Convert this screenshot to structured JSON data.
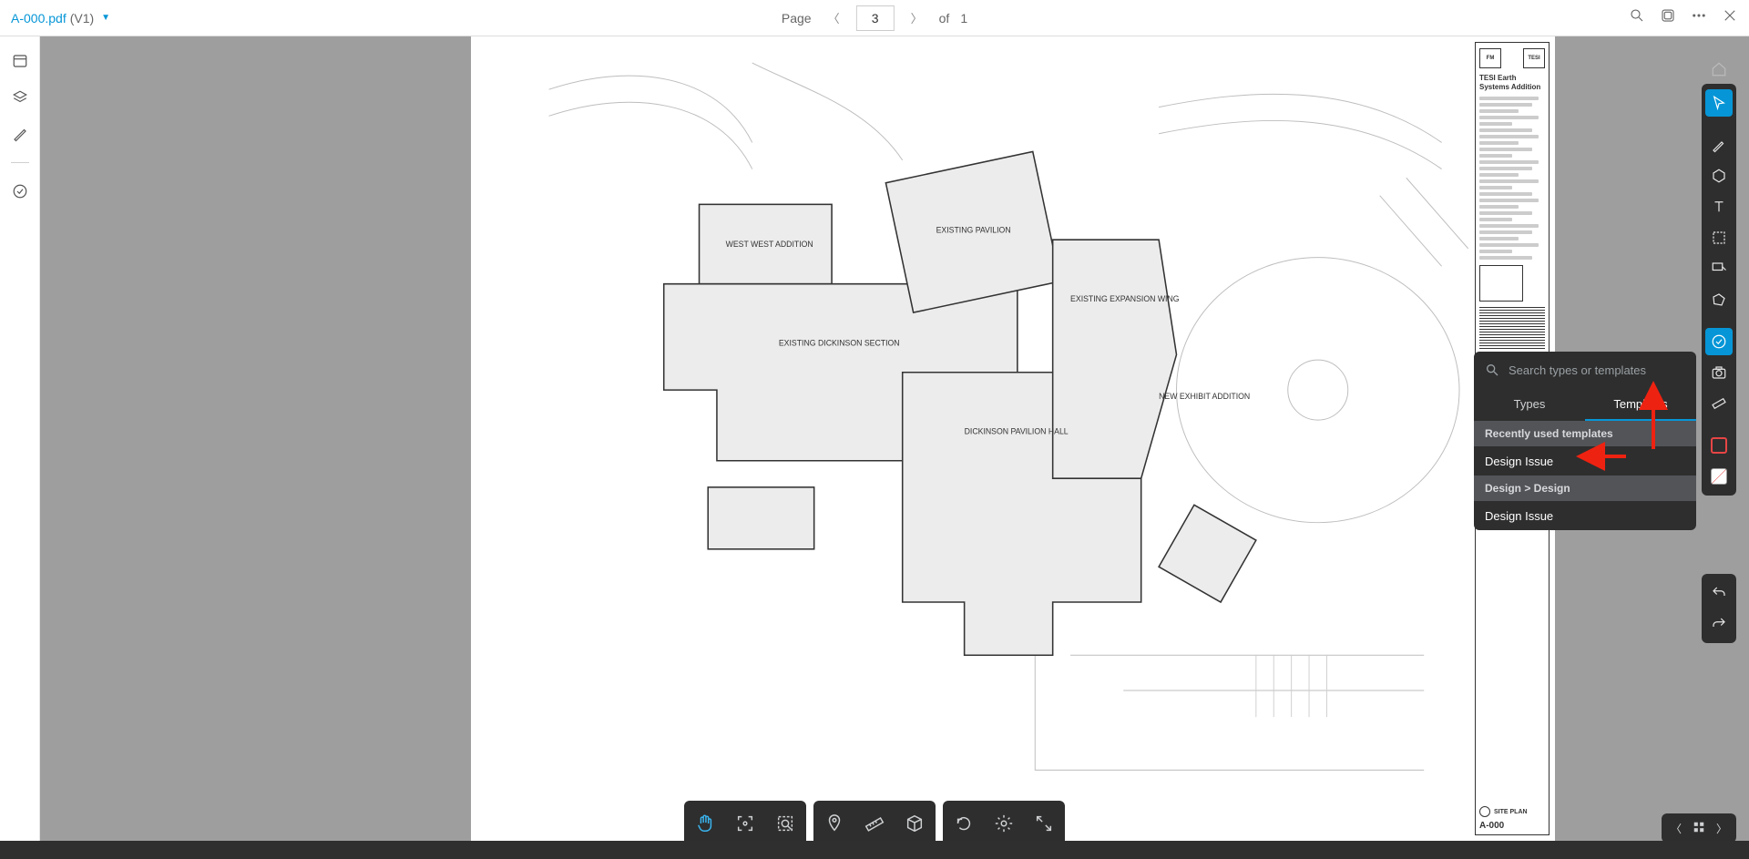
{
  "header": {
    "file_name": "A-000.pdf",
    "file_version": "(V1)",
    "page_label": "Page",
    "page_value": "3",
    "page_of": "of",
    "page_total": "1"
  },
  "title_block": {
    "project": "TESI Earth Systems Addition",
    "logo_left": "FM",
    "logo_right": "TESI",
    "sheet_name": "SITE PLAN",
    "sheet_number": "A-000"
  },
  "plan_labels": {
    "a": "WEST WEST ADDITION",
    "b": "EXISTING DICKINSON SECTION",
    "c": "EXISTING PAVILION",
    "d": "EXISTING EXPANSION WING",
    "e": "DICKINSON PAVILION HALL",
    "f": "NEW EXHIBIT ADDITION"
  },
  "popup": {
    "search_placeholder": "Search types or templates",
    "tab_types": "Types",
    "tab_templates": "Templates",
    "section_recent": "Recently used templates",
    "section_design": "Design > Design",
    "item_issue": "Design Issue"
  },
  "left_rail_names": [
    "panel-icon",
    "layers-icon",
    "pen-icon",
    "check-circle-icon"
  ],
  "bottom_bars": {
    "group1": [
      "hand-icon",
      "focus-icon",
      "lasso-zoom-icon"
    ],
    "group2": [
      "pin-icon",
      "ruler-icon",
      "cube-icon"
    ],
    "group3": [
      "rotate-icon",
      "gear-icon",
      "expand-icon"
    ]
  },
  "tool_rail": [
    "cursor-icon",
    "pen-tool-icon",
    "hexagon-icon",
    "text-icon",
    "marquee-icon",
    "callout-icon",
    "polygon-icon",
    "issue-circle-icon",
    "camera-icon",
    "measure-icon"
  ]
}
